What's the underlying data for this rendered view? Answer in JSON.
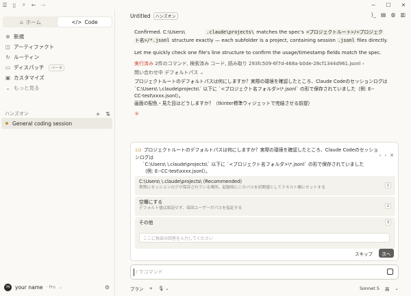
{
  "window": {
    "controls": [
      "─",
      "☐",
      "✕"
    ]
  },
  "titlebar": {
    "icons": [
      "menu-icon",
      "sidebar-toggle-icon",
      "search-icon",
      "back-icon",
      "forward-icon"
    ]
  },
  "sidebar": {
    "modes": [
      {
        "label": "ホーム",
        "icon": "home-icon",
        "active": false
      },
      {
        "label": "Code",
        "icon": "code-icon",
        "active": true
      }
    ],
    "nav": [
      {
        "label": "新規",
        "icon": "plus-icon"
      },
      {
        "label": "アーティファクト",
        "icon": "artifact-icon"
      },
      {
        "label": "ルーティン",
        "icon": "routine-icon"
      },
      {
        "label": "ディスパッチ",
        "icon": "dispatch-icon",
        "badge": "ベータ"
      },
      {
        "label": "カスタマイズ",
        "icon": "customize-icon"
      },
      {
        "label": "もっと見る",
        "icon": "chevron-down-icon"
      }
    ],
    "section_label": "ハンズオン",
    "session": "General coding session",
    "user": {
      "initials": "YN",
      "name": "your name",
      "plan": "Pro"
    }
  },
  "header": {
    "title": "Untitled",
    "tag": "ハンズオン"
  },
  "messages": {
    "line1_a": "Confirmed. C:\\Users\\",
    "line1_b": ".claude\\projects\\",
    "line1_c": " matches the spec's ",
    "line1_d": "<プロジェクトルート>/<プロジェク",
    "line2_a": "ト名>/*.jsonl",
    "line2_b": " structure exactly — each subfolder is a project, containing session ",
    "line2_c": ".jsonl",
    "line2_d": " files directly.",
    "para2": "Let me quickly check one file's line structure to confirm the usage/timestamp fields match the spec.",
    "tool_status": "実行済み",
    "tool_detail": " 2件のコマンド, 検索済み コード, 読み取り 293fc509-6f7d-468a-b0de-28cf1344d961.jsonl ›",
    "thinking": "問い合わせ中 デフォルトパス ⌄",
    "jp1": "プロジェクトルートのデフォルトパスは何にしますか？実際の環境を確認したところ、Claude Codeのセッションログは",
    "jp2": "`C:\\Users\\          \\.claude\\projects\\` 以下に `<プロジェクト名フォルダ>\\*.jsonl` の形で保存されていました（例: E--",
    "jp3": "CC-test\\xxxx.jsonl）。",
    "jp4": "画面の配色・見た目はどうしますか？（tkinter標準ウィジェットで完結させる前提）"
  },
  "question": {
    "counter": "1/2",
    "text1": "プロジェクトルートのデフォルトパスは何にしますか？実際の環境を確認したところ、Claude Codeのセッションログは",
    "text2": "`C:\\Users\\          \\.claude\\projects\\` 以下に `<プロジェクト名フォルダ>\\*.jsonl` の形で保存されていました",
    "text3": "（例: E--CC-test\\xxxx.jsonl）。",
    "nav": [
      "‹",
      "›",
      "✕"
    ],
    "options": [
      {
        "title": "C:\\Users\\            \\.claude\\projects\\ (Recommended)",
        "desc": "実際にセッションログが保存されている場所。起動時にこのパスを初期値としてテキスト欄にセットする",
        "key": "1"
      },
      {
        "title": "空欄にする",
        "desc": "デフォルト値は設定せず、毎回ユーザーがパスを指定する",
        "key": "2"
      },
      {
        "title": "その他",
        "desc": "",
        "key": "3"
      }
    ],
    "other_placeholder": "ここに独自の回答を入力してください",
    "skip": "スキップ",
    "next": "次へ"
  },
  "composer": {
    "placeholder": "/ でコマンド"
  },
  "bottom": {
    "mode": "プラン",
    "model": "Sonnet 5",
    "effort": "高"
  }
}
